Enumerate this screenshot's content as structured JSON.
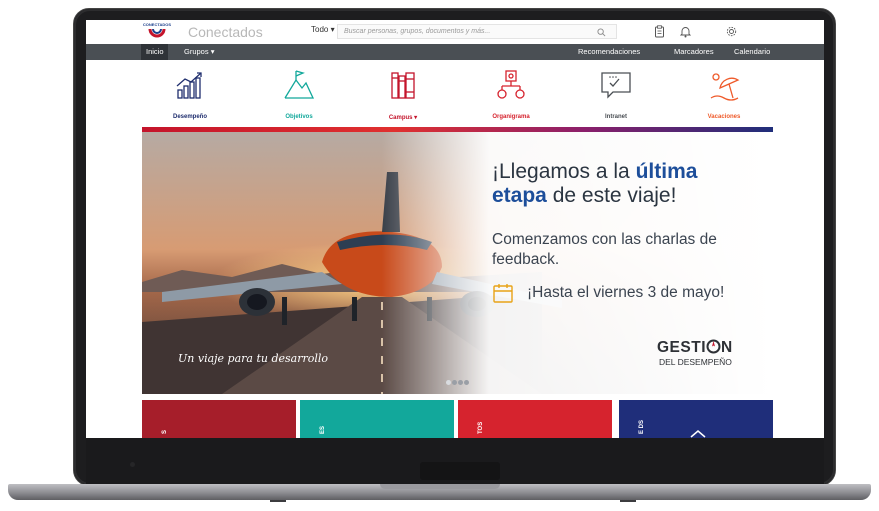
{
  "app": {
    "logo_text": "CONECTADOS",
    "brand": "Conectados"
  },
  "search": {
    "scope": "Todo",
    "placeholder": "Buscar personas, grupos, documentos y más..."
  },
  "nav": {
    "left": [
      "Inicio",
      "Grupos"
    ],
    "right": [
      "Recomendaciones",
      "Marcadores",
      "Calendario"
    ]
  },
  "quick_links": [
    {
      "label": "Desempeño",
      "color": "#1f2e6e",
      "icon": "chart-growth-icon"
    },
    {
      "label": "Objetivos",
      "color": "#12a89b",
      "icon": "mountain-flag-icon"
    },
    {
      "label": "Campus",
      "color": "#c4142b",
      "icon": "books-icon"
    },
    {
      "label": "Organigrama",
      "color": "#d6232e",
      "icon": "org-chart-icon"
    },
    {
      "label": "Intranet",
      "color": "#4a4f54",
      "icon": "chat-screen-icon"
    },
    {
      "label": "Vacaciones",
      "color": "#ef5a2a",
      "icon": "beach-umbrella-icon"
    }
  ],
  "banner": {
    "h1_part1": "¡Llegamos a la ",
    "h1_accent1": "última",
    "h1_accent2": "etapa",
    "h1_part2": " de este viaje!",
    "subtitle": "Comenzamos con las charlas de feedback.",
    "date_line": "¡Hasta el viernes 3 de mayo!",
    "tagline": "Un viaje para tu desarrollo",
    "program_title_a": "GESTI",
    "program_title_b": "N",
    "program_sub": "DEL DESEMPEÑO",
    "slide_dots": [
      false,
      true,
      true,
      true
    ]
  },
  "tiles": [
    {
      "label": "S",
      "color": "#a61e2a"
    },
    {
      "label": "ES",
      "color": "#12a89b"
    },
    {
      "label": "TOS",
      "color": "#d6232e"
    },
    {
      "label": "E DS",
      "color": "#1f2e7a"
    }
  ],
  "colors": {
    "navbar": "#4a4f54",
    "accent_blue": "#1d4e9a",
    "accent_red": "#c4142b"
  }
}
